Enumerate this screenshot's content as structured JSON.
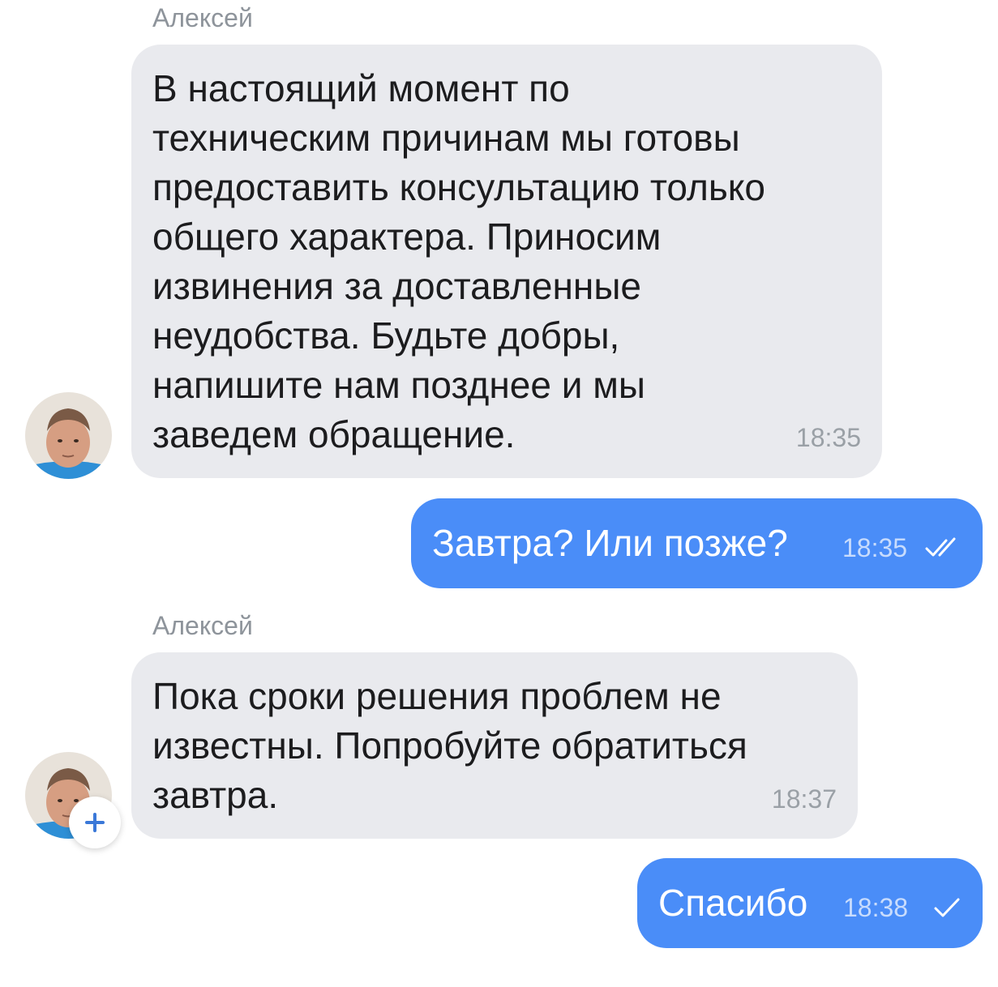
{
  "messages": [
    {
      "sender": "Алексей",
      "text": "В настоящий момент по\nтехническим причинам мы готовы\nпредоставить консультацию только\nобщего характера. Приносим\nизвинения за доставленные\nнеудобства. Будьте добры,\nнапишите нам позднее и мы\nзаведем обращение.",
      "time": "18:35"
    },
    {
      "text": "Завтра? Или позже?",
      "time": "18:35",
      "status": "read"
    },
    {
      "sender": "Алексей",
      "text": "Пока сроки решения проблем не\nизвестны. Попробуйте обратиться\nзавтра.",
      "time": "18:37"
    },
    {
      "text": "Спасибо",
      "time": "18:38",
      "status": "sent"
    }
  ],
  "colors": {
    "incoming_bubble": "#e9eaee",
    "outgoing_bubble": "#4a8df8",
    "name_text": "#8e949b"
  },
  "icons": {
    "avatar": "avatar",
    "double_check": "double-check-icon",
    "single_check": "check-icon",
    "add": "plus-icon"
  }
}
